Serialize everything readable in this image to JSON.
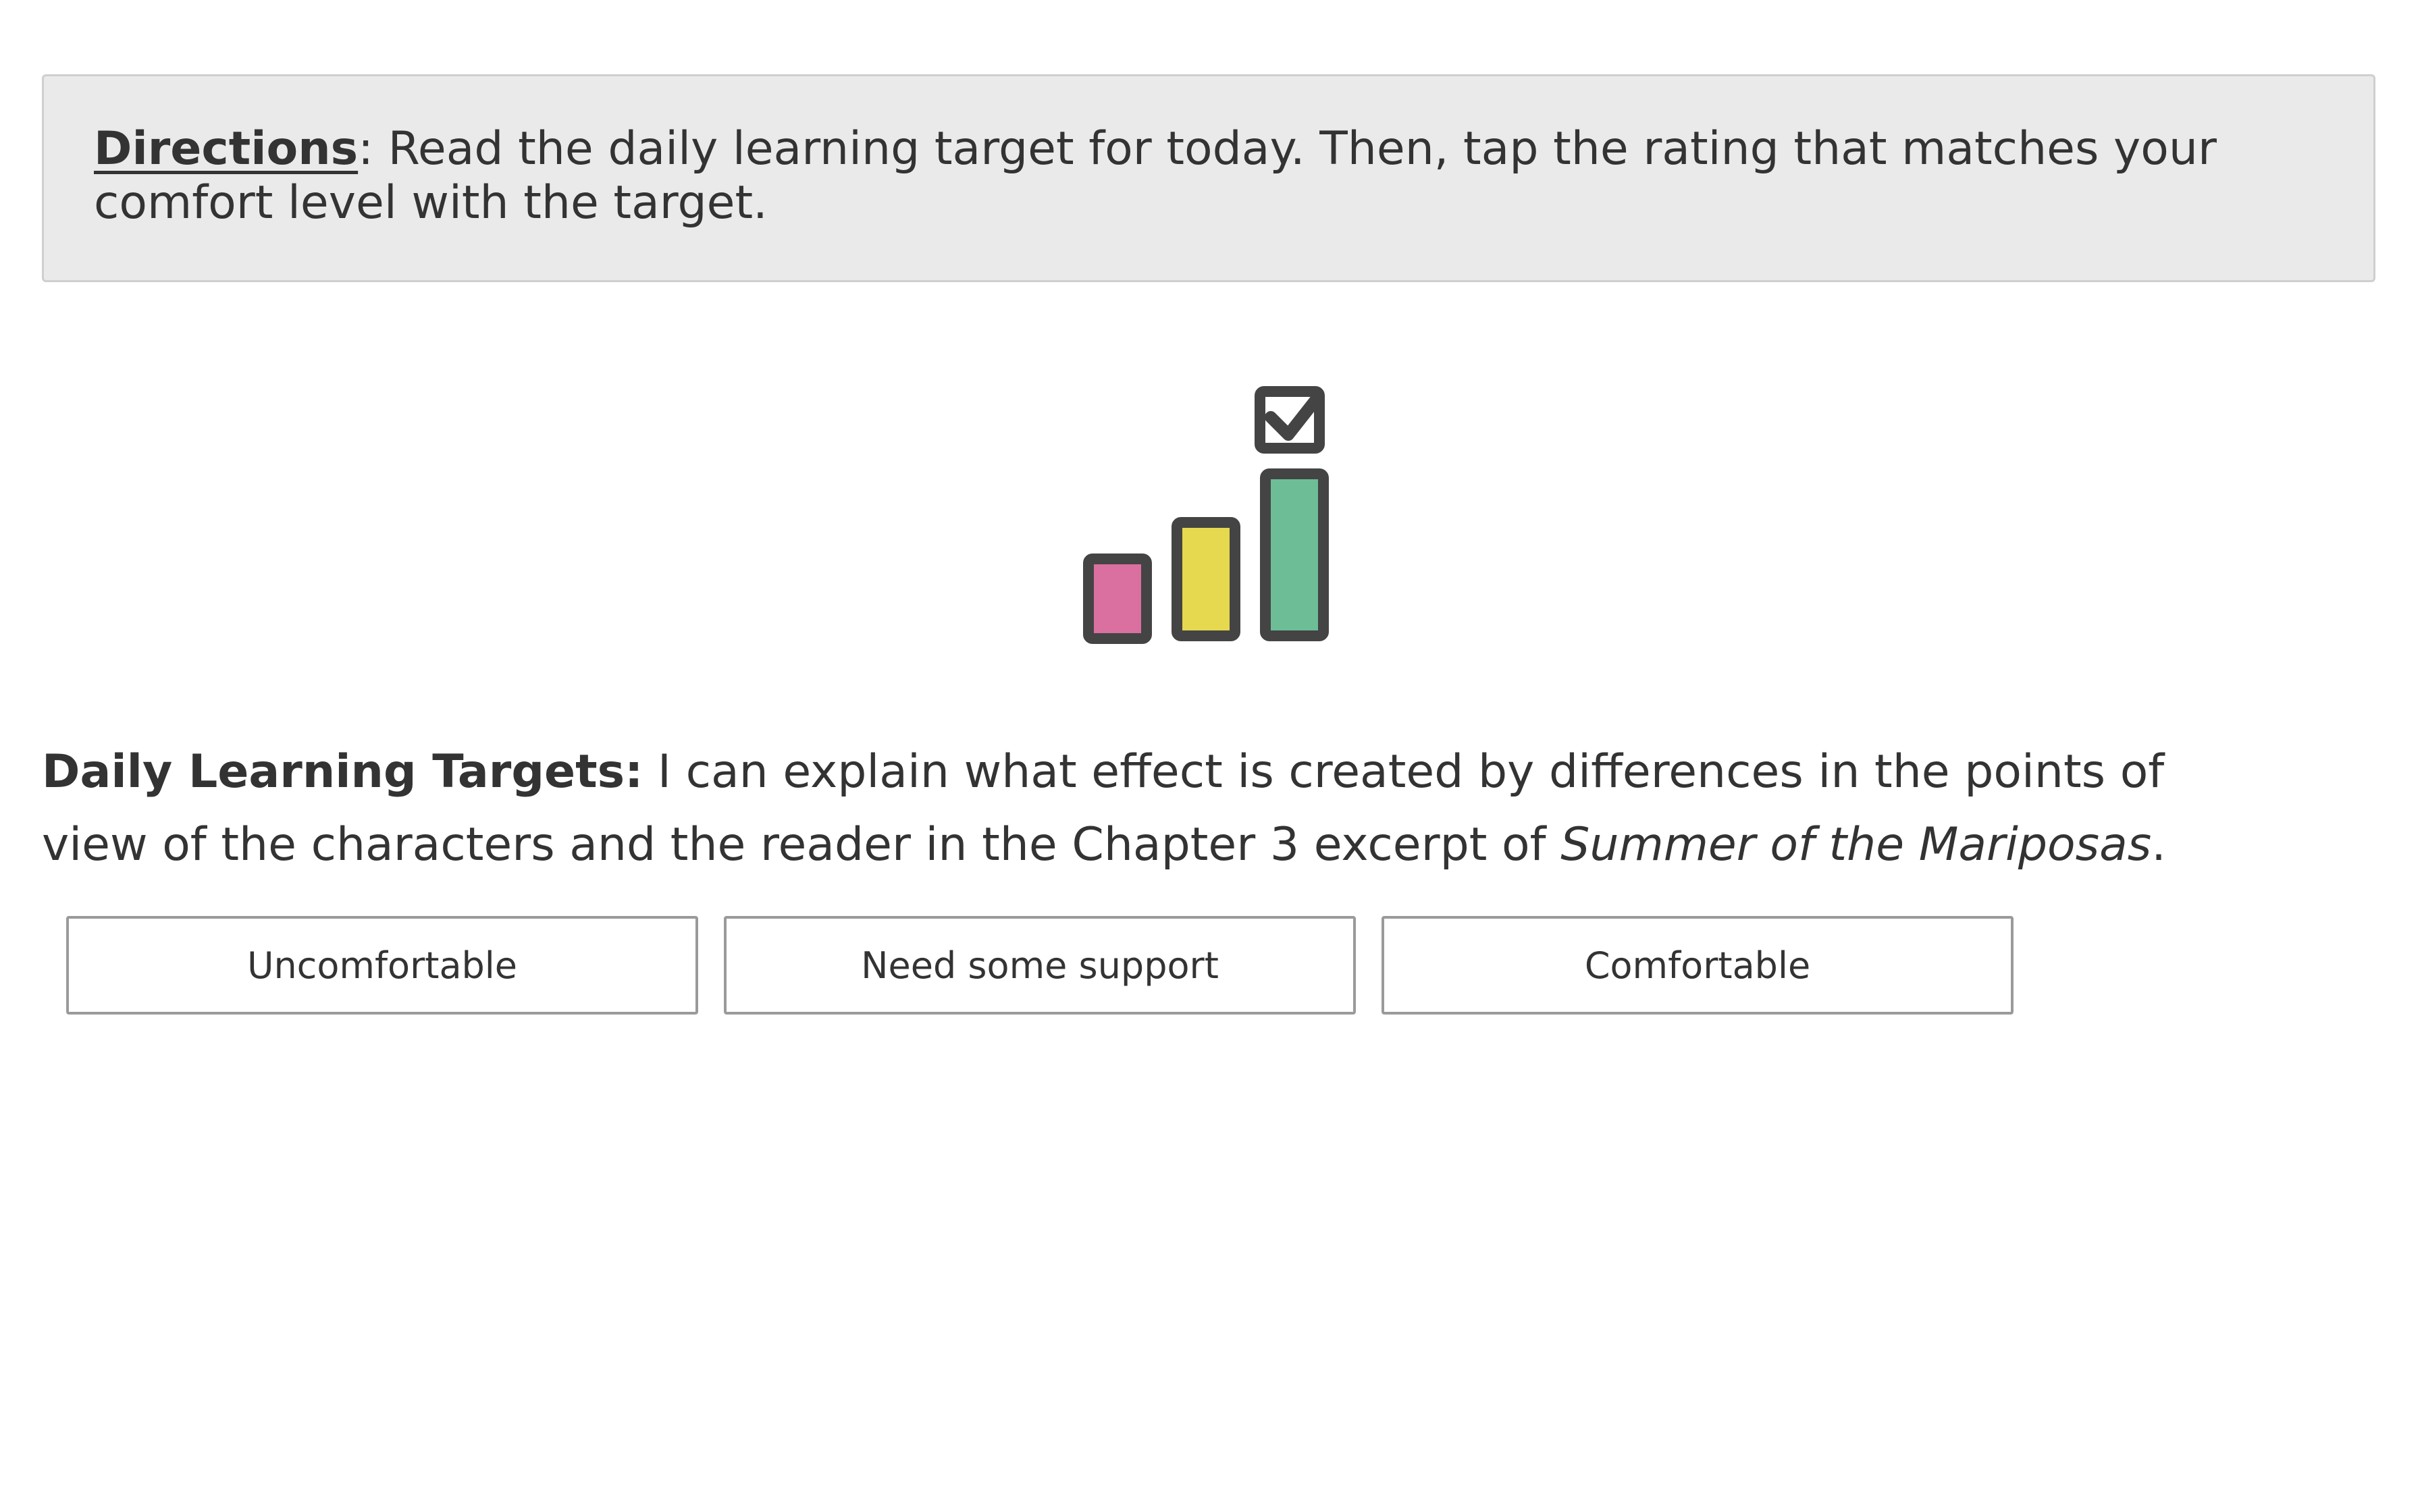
{
  "directions": {
    "label": "Directions",
    "text": ": Read the daily learning target for today. Then, tap the rating that matches your comfort level with the target."
  },
  "graphic": {
    "icon": "comfort-rating-bars-icon",
    "colors": {
      "outline": "#444444",
      "low": "#d9709f",
      "medium": "#e6d84f",
      "high": "#6dbd96"
    }
  },
  "target": {
    "label": "Daily Learning Targets:",
    "text_before": " I can explain what effect is created by differences in the points of view of the characters and the reader in the Chapter 3 excerpt of ",
    "book_title": "Summer of the Mariposas",
    "text_after": "."
  },
  "ratings": [
    {
      "label": "Uncomfortable"
    },
    {
      "label": "Need some support"
    },
    {
      "label": "Comfortable"
    }
  ],
  "colors": {
    "directions_background": "#eaeaea",
    "text": "#333333",
    "button_border": "#9a9a9a"
  }
}
